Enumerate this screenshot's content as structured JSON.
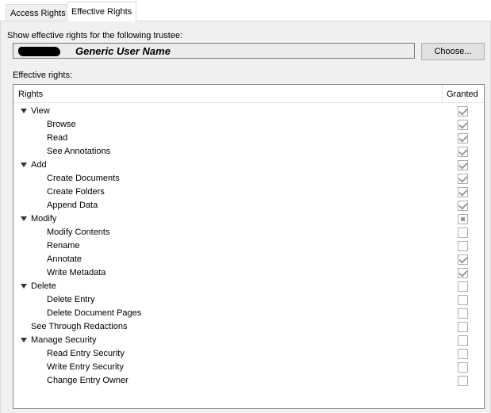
{
  "tabs": [
    {
      "label": "Access Rights",
      "active": false
    },
    {
      "label": "Effective Rights",
      "active": true
    }
  ],
  "trustee": {
    "prompt": "Show effective rights for the following trustee:",
    "name": "Generic User Name",
    "choose_label": "Choose..."
  },
  "effective": {
    "label": "Effective rights:",
    "columns": {
      "rights": "Rights",
      "granted": "Granted"
    },
    "rows": [
      {
        "label": "View",
        "level": 0,
        "expander": true,
        "state": "checked"
      },
      {
        "label": "Browse",
        "level": 1,
        "expander": false,
        "state": "checked"
      },
      {
        "label": "Read",
        "level": 1,
        "expander": false,
        "state": "checked"
      },
      {
        "label": "See Annotations",
        "level": 1,
        "expander": false,
        "state": "checked"
      },
      {
        "label": "Add",
        "level": 0,
        "expander": true,
        "state": "checked"
      },
      {
        "label": "Create Documents",
        "level": 1,
        "expander": false,
        "state": "checked"
      },
      {
        "label": "Create Folders",
        "level": 1,
        "expander": false,
        "state": "checked"
      },
      {
        "label": "Append Data",
        "level": 1,
        "expander": false,
        "state": "checked"
      },
      {
        "label": "Modify",
        "level": 0,
        "expander": true,
        "state": "partial"
      },
      {
        "label": "Modify Contents",
        "level": 1,
        "expander": false,
        "state": "unchecked"
      },
      {
        "label": "Rename",
        "level": 1,
        "expander": false,
        "state": "unchecked"
      },
      {
        "label": "Annotate",
        "level": 1,
        "expander": false,
        "state": "checked"
      },
      {
        "label": "Write Metadata",
        "level": 1,
        "expander": false,
        "state": "checked"
      },
      {
        "label": "Delete",
        "level": 0,
        "expander": true,
        "state": "unchecked"
      },
      {
        "label": "Delete Entry",
        "level": 1,
        "expander": false,
        "state": "unchecked"
      },
      {
        "label": "Delete Document Pages",
        "level": 1,
        "expander": false,
        "state": "unchecked"
      },
      {
        "label": "See Through Redactions",
        "level": 0,
        "expander": false,
        "state": "unchecked"
      },
      {
        "label": "Manage Security",
        "level": 0,
        "expander": true,
        "state": "unchecked"
      },
      {
        "label": "Read Entry Security",
        "level": 1,
        "expander": false,
        "state": "unchecked"
      },
      {
        "label": "Write Entry Security",
        "level": 1,
        "expander": false,
        "state": "unchecked"
      },
      {
        "label": "Change Entry Owner",
        "level": 1,
        "expander": false,
        "state": "unchecked"
      }
    ]
  }
}
